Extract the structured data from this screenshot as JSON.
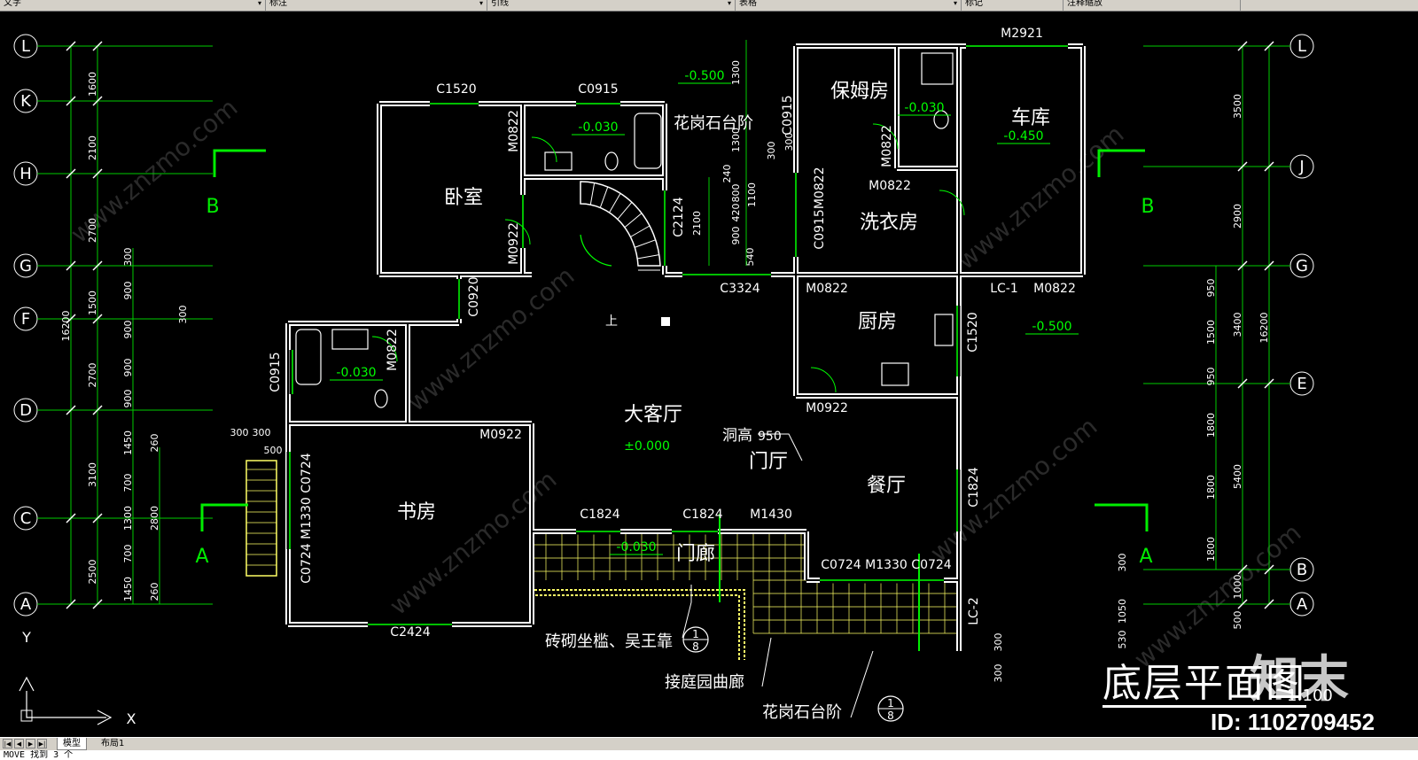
{
  "toolbar": {
    "panels": [
      {
        "label": "文字"
      },
      {
        "label": "标注"
      },
      {
        "label": "引线"
      },
      {
        "label": "表格"
      },
      {
        "label": "标记"
      },
      {
        "label": "注释缩放"
      }
    ]
  },
  "drawing": {
    "title": "底层平面图",
    "scale": "1:100",
    "grid_left": [
      "L",
      "K",
      "H",
      "G",
      "F",
      "D",
      "C",
      "A"
    ],
    "grid_right": [
      "L",
      "J",
      "G",
      "E",
      "B",
      "A"
    ],
    "rooms": {
      "bedroom": "卧室",
      "nanny_room": "保姆房",
      "garage": "车库",
      "laundry": "洗衣房",
      "kitchen": "厨房",
      "living_room": "大客厅",
      "foyer": "门厅",
      "dining": "餐厅",
      "study": "书房",
      "porch": "门廊"
    },
    "notes": {
      "granite_steps_top": "花岗石台阶",
      "granite_steps_bottom": "花岗石台阶",
      "brick_bench": "砖砌坐槛、吴王靠",
      "garden_corridor": "接庭园曲廊",
      "opening_height": "洞高",
      "opening_height_value": "950",
      "stair_up": "上"
    },
    "elevations": {
      "living": "±0.000",
      "top_step": "-0.500",
      "bath_top": "-0.030",
      "nanny_bath": "-0.030",
      "garage": "-0.450",
      "right_side": "-0.500",
      "left_bath": "-0.030",
      "porch": "-0.030"
    },
    "openings": {
      "c1520": "C1520",
      "c0915_top": "C0915",
      "m2921": "M2921",
      "m0822_bed": "M0822",
      "m0922_bed": "M0922",
      "c2124": "C2124",
      "c3324": "C3324",
      "m0822_nanny": "M0822",
      "m0822_laundry": "M0822",
      "c0915m0822": "C0915M0822",
      "c0915_right": "C0915",
      "m0822_kitchen": "M0822",
      "lc1": "LC-1",
      "m0822_garage": "M0822",
      "c1520_right": "C1520",
      "m0922_kitchen": "M0922",
      "c0920": "C0920",
      "c0915_left": "C0915",
      "m0822_leftbath": "M0822",
      "m0922_study": "M0922",
      "c1824_a": "C1824",
      "c1824_b": "C1824",
      "m1430": "M1430",
      "c1824_right": "C1824",
      "c0724_m1330": "C0724 M1330 C0724",
      "c0724_m1330_v": "C0724 M1330 C0724",
      "c2424": "C2424",
      "lc2": "LC-2"
    },
    "section_marks": {
      "b": "B",
      "a": "A"
    },
    "detail_marks": [
      {
        "top": "1",
        "bottom": "8"
      },
      {
        "top": "1",
        "bottom": "8"
      }
    ],
    "dims_left_outer": [
      "1600",
      "2100",
      "2700",
      "1500",
      "2700",
      "3100",
      "2500"
    ],
    "dims_left_total": "16200",
    "dims_left_inner": [
      "300",
      "900",
      "900",
      "900",
      "900",
      "1450",
      "700",
      "1300",
      "700",
      "1450"
    ],
    "dims_left_inner2": [
      "300",
      "260",
      "2800",
      "260"
    ],
    "dims_left_small": [
      "300",
      "300",
      "500"
    ],
    "dims_right_outer": [
      "3500",
      "2900",
      "3400",
      "5400",
      "1000",
      "500"
    ],
    "dims_right_total": "16200",
    "dims_right_inner": [
      "950",
      "1500",
      "950",
      "1800",
      "1800",
      "1800"
    ],
    "dims_right_small": [
      "300",
      "1050",
      "530"
    ],
    "dims_center": [
      "1300",
      "1300",
      "240",
      "800",
      "420",
      "900",
      "300",
      "300",
      "1100",
      "2100",
      "540"
    ],
    "dims_bottom": [
      "300",
      "300"
    ]
  },
  "tabs": {
    "model": "模型",
    "layout1": "布局1"
  },
  "watermark": {
    "brand": "知末",
    "id": "ID: 1102709452",
    "site": "www.znzmo.com"
  },
  "command": "MOVE 找到 3 个",
  "colors": {
    "wall": "#ffffff",
    "grid": "#00ff00",
    "dim": "#00cc00",
    "text": "#ffffff",
    "section": "#00ee00",
    "hatch": "#ffff66"
  }
}
